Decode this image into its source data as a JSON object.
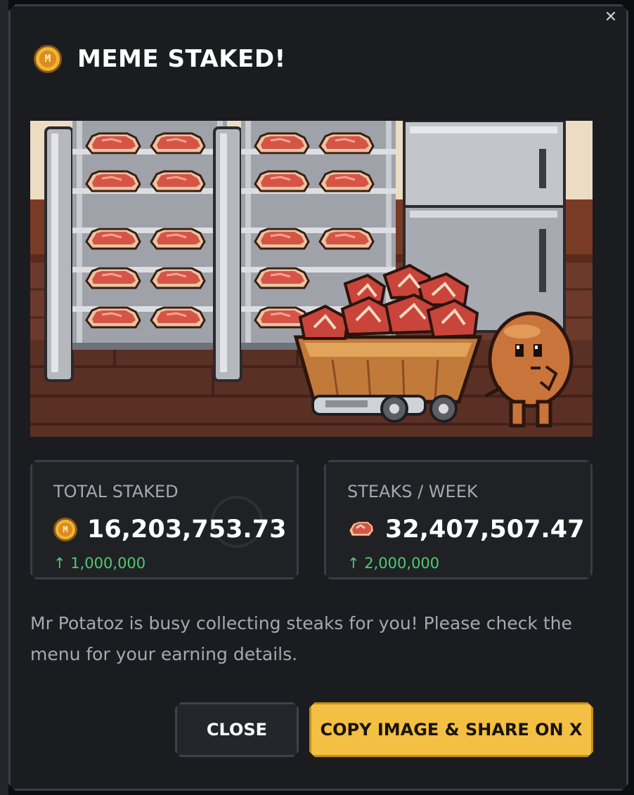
{
  "modal": {
    "close_glyph": "✕",
    "title": "MEME STAKED!",
    "title_coin_letter": "M",
    "image_alt": "Mr Potatoz next to a cart of steaks in a kitchen with steak racks and a fridge"
  },
  "stats": {
    "total_staked": {
      "label": "TOTAL STAKED",
      "coin_letter": "M",
      "value": "16,203,753.73",
      "delta": "↑ 1,000,000"
    },
    "steaks_per_week": {
      "label": "STEAKS / WEEK",
      "value": "32,407,507.47",
      "delta": "↑ 2,000,000"
    }
  },
  "description": "Mr Potatoz is busy collecting steaks for you! Please check the menu for your earning details.",
  "buttons": {
    "close_label": "CLOSE",
    "share_label": "COPY IMAGE & SHARE ON X"
  },
  "colors": {
    "accent": "#f3c043",
    "positive": "#4fca6e",
    "panel": "#1a1c20"
  }
}
